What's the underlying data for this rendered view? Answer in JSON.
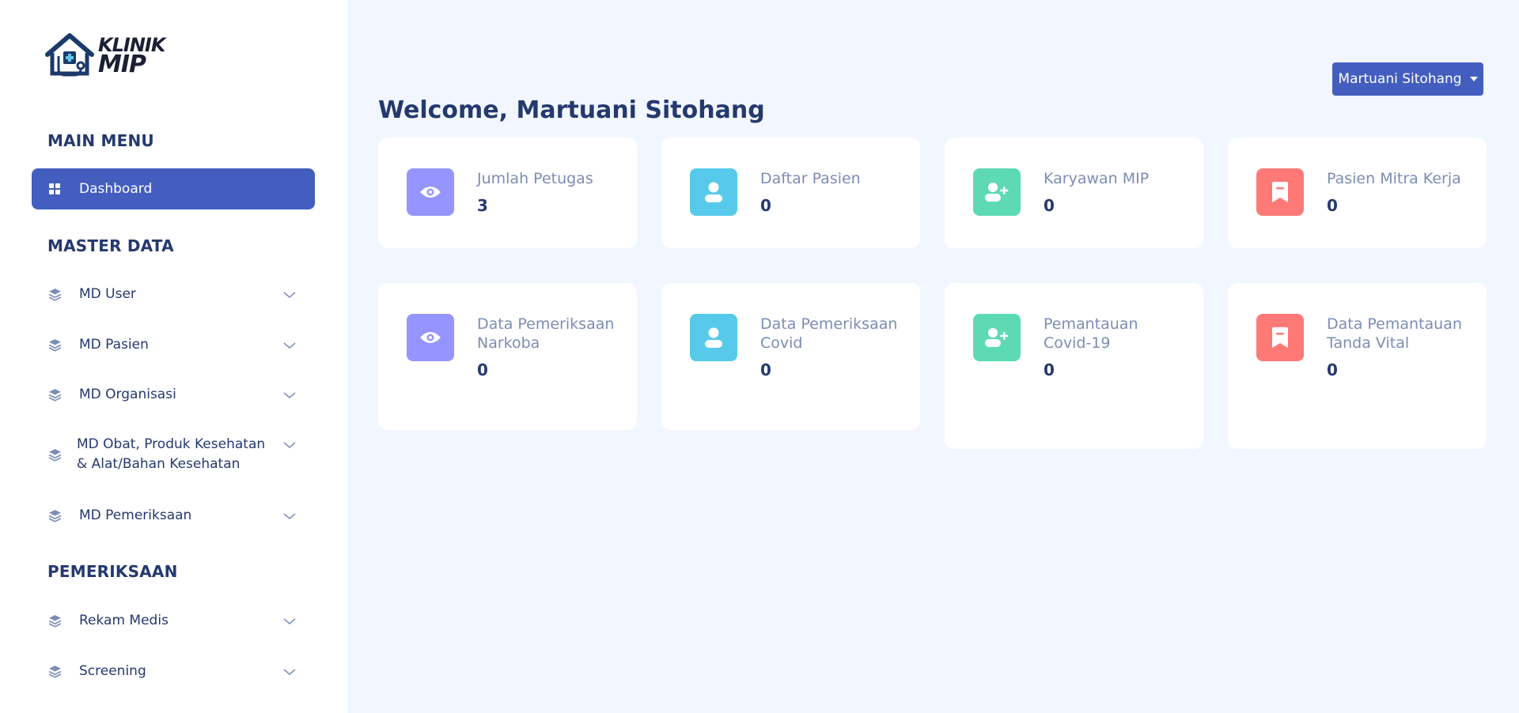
{
  "app": {
    "logo_line1": "KLINIK",
    "logo_line2": "MIP"
  },
  "sidebar": {
    "section_main": "MAIN MENU",
    "dashboard": "Dashboard",
    "section_master": "MASTER DATA",
    "master_items": [
      {
        "label": "MD User"
      },
      {
        "label": "MD Pasien"
      },
      {
        "label": "MD Organisasi"
      },
      {
        "label": "MD Obat, Produk Kesehatan & Alat/Bahan Kesehatan"
      },
      {
        "label": "MD Pemeriksaan"
      }
    ],
    "section_exam": "PEMERIKSAAN",
    "exam_items": [
      {
        "label": "Rekam Medis"
      },
      {
        "label": "Screening"
      }
    ]
  },
  "header": {
    "user_name": "Martuani Sitohang",
    "welcome": "Welcome, Martuani Sitohang"
  },
  "cards": [
    {
      "title": "Jumlah Petugas",
      "value": "3",
      "icon": "eye-icon",
      "color": "#9694ff"
    },
    {
      "title": "Daftar Pasien",
      "value": "0",
      "icon": "user-icon",
      "color": "#57caeb"
    },
    {
      "title": "Karyawan MIP",
      "value": "0",
      "icon": "user-plus-icon",
      "color": "#5ddab4"
    },
    {
      "title": "Pasien Mitra Kerja",
      "value": "0",
      "icon": "bookmark-icon",
      "color": "#ff7976"
    },
    {
      "title": "Data Pemeriksaan Narkoba",
      "value": "0",
      "icon": "eye-icon",
      "color": "#9694ff"
    },
    {
      "title": "Data Pemeriksaan Covid",
      "value": "0",
      "icon": "user-icon",
      "color": "#57caeb"
    },
    {
      "title": "Pemantauan Covid-19",
      "value": "0",
      "icon": "user-plus-icon",
      "color": "#5ddab4"
    },
    {
      "title": "Data Pemantauan Tanda Vital",
      "value": "0",
      "icon": "bookmark-icon",
      "color": "#ff7976"
    }
  ]
}
